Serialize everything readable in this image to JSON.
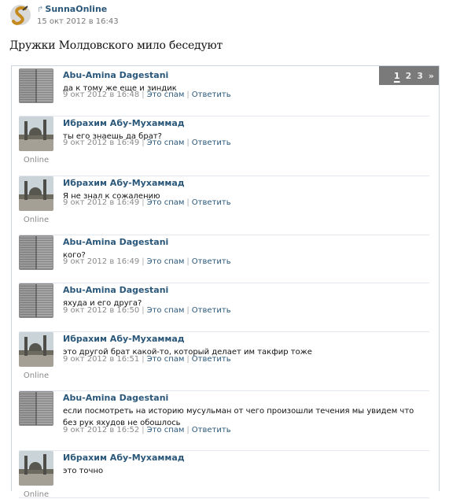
{
  "post": {
    "author": "SunnaOnline",
    "date": "15 окт 2012 в 16:43",
    "title": "Дружки Молдовского мило беседуют",
    "logo_icon": "sunna-logo-icon",
    "repost_icon": "repost-icon"
  },
  "pager": {
    "pages": [
      "1",
      "2",
      "3",
      "»"
    ],
    "active": "1"
  },
  "labels": {
    "spam": "Это спам",
    "reply": "Ответить",
    "online": "Online"
  },
  "comments": [
    {
      "author": "Abu-Amina Dagestani",
      "text": "да к тому же еще и зиндик",
      "date": "9 окт 2012 в 16:48",
      "online": false,
      "avatar": "book"
    },
    {
      "author": "Ибрахим Абу-Мухаммад",
      "text": "ты его знаешь да брат?",
      "date": "9 окт 2012 в 16:49",
      "online": true,
      "avatar": "mosque"
    },
    {
      "author": "Ибрахим Абу-Мухаммад",
      "text": "Я не знал к сожалению",
      "date": "9 окт 2012 в 16:49",
      "online": true,
      "avatar": "mosque"
    },
    {
      "author": "Abu-Amina Dagestani",
      "text": "кого?",
      "date": "9 окт 2012 в 16:49",
      "online": false,
      "avatar": "book"
    },
    {
      "author": "Abu-Amina Dagestani",
      "text": "яхуда и его друга?",
      "date": "9 окт 2012 в 16:50",
      "online": false,
      "avatar": "book"
    },
    {
      "author": "Ибрахим Абу-Мухаммад",
      "text": "это другой брат какой-то, который делает им такфир тоже",
      "date": "9 окт 2012 в 16:51",
      "online": true,
      "avatar": "mosque"
    },
    {
      "author": "Abu-Amina Dagestani",
      "text": "если посмотреть на историю мусульман от чего произошли течения мы увидем что без рук яхудов не обошлось",
      "date": "9 окт 2012 в 16:52",
      "online": false,
      "avatar": "book"
    },
    {
      "author": "Ибрахим Абу-Мухаммад",
      "text": "это точно",
      "date": "",
      "online": true,
      "avatar": "mosque"
    }
  ]
}
